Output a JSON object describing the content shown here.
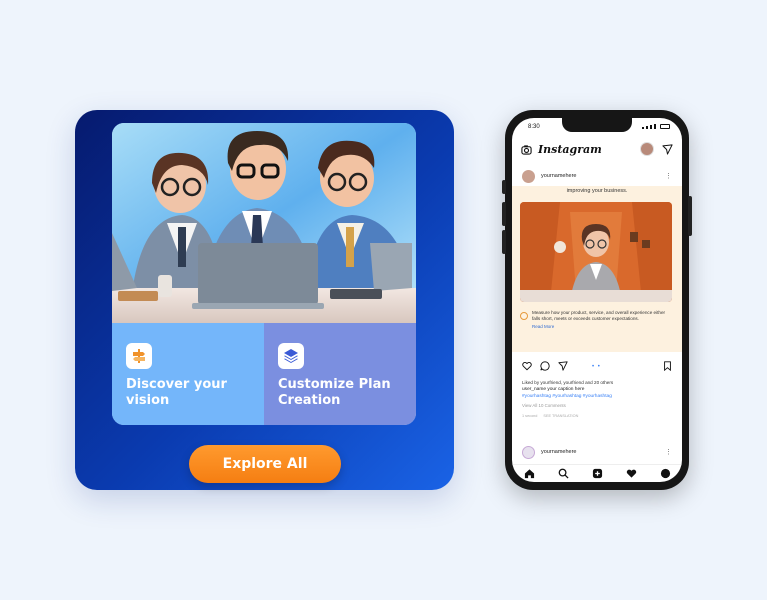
{
  "promo": {
    "tiles": [
      {
        "label": "Discover your vision",
        "icon": "signpost-icon"
      },
      {
        "label": "Customize Plan Creation",
        "icon": "layers-icon"
      }
    ],
    "button_label": "Explore All",
    "colors": {
      "card": "#0a3bb0",
      "tile_left": "#74b6fa",
      "tile_right": "#7b8fe0",
      "button": "#f58a1f"
    }
  },
  "phone": {
    "status_time": "8:30",
    "app_name": "Instagram",
    "post": {
      "username": "yournamehere",
      "caption_top": "improving your business.",
      "body_text": "Measure how your product, service, and overall experience either falls short, meets or exceeds customer expectations.",
      "read_more": "Read More",
      "likes": "Liked by yourfriend, yourfriend and 20 others",
      "caption": "user_name  your caption here",
      "hashtags": "#yourhashtag #yourhashtag #yourhashtag",
      "view_all": "View All 10 Comments",
      "meta_time": "1 second",
      "meta_translate": "SEE TRANSLATION"
    },
    "next_post_username": "yournamehere",
    "nav_icons": [
      "home-icon",
      "search-icon",
      "add-icon",
      "heart-icon",
      "profile-icon"
    ]
  }
}
